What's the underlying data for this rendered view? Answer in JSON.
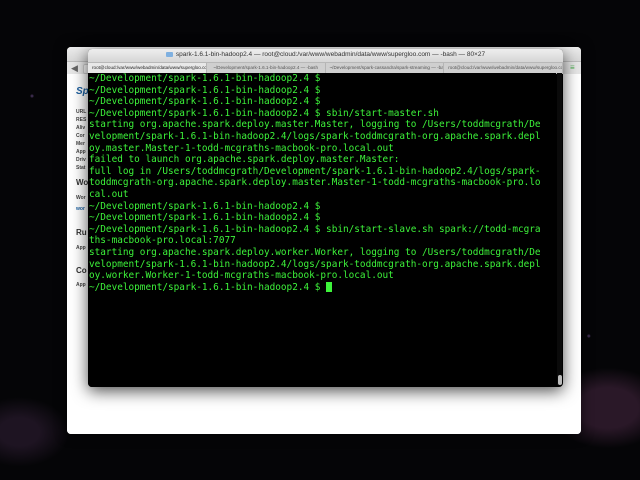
{
  "terminal": {
    "title": "spark-1.6.1-bin-hadoop2.4 — root@cloud:/var/www/webadmin/data/www/supergloo.com — -bash — 80×27",
    "tabs": [
      "root@cloud:/var/www/webadmin/data/www/supergloo.com",
      "~/Development/spark-1.6.1-bin-hadoop2.4 — -bash",
      "~/Development/spark-cassandra/spark-streaming — -bash",
      "root@cloud:/var/www/webadmin/data/www/supergloo.com/"
    ],
    "lines": [
      "~/Development/spark-1.6.1-bin-hadoop2.4 $",
      "~/Development/spark-1.6.1-bin-hadoop2.4 $",
      "~/Development/spark-1.6.1-bin-hadoop2.4 $",
      "~/Development/spark-1.6.1-bin-hadoop2.4 $ sbin/start-master.sh",
      "starting org.apache.spark.deploy.master.Master, logging to /Users/toddmcgrath/De",
      "velopment/spark-1.6.1-bin-hadoop2.4/logs/spark-toddmcgrath-org.apache.spark.depl",
      "oy.master.Master-1-todd-mcgraths-macbook-pro.local.out",
      "failed to launch org.apache.spark.deploy.master.Master:",
      "full log in /Users/toddmcgrath/Development/spark-1.6.1-bin-hadoop2.4/logs/spark-",
      "toddmcgrath-org.apache.spark.deploy.master.Master-1-todd-mcgraths-macbook-pro.lo",
      "cal.out",
      "~/Development/spark-1.6.1-bin-hadoop2.4 $",
      "~/Development/spark-1.6.1-bin-hadoop2.4 $",
      "~/Development/spark-1.6.1-bin-hadoop2.4 $ sbin/start-slave.sh spark://todd-mcgra",
      "ths-macbook-pro.local:7077",
      "starting org.apache.spark.deploy.worker.Worker, logging to /Users/toddmcgrath/De",
      "velopment/spark-1.6.1-bin-hadoop2.4/logs/spark-toddmcgrath-org.apache.spark.depl",
      "oy.worker.Worker-1-todd-mcgraths-macbook-pro.local.out"
    ],
    "prompt": "~/Development/spark-1.6.1-bin-hadoop2.4 $ "
  },
  "browser": {
    "sidebar_title": "Sp",
    "sidebar_labels": [
      "URL",
      "RES",
      "Aliv",
      "Cor",
      "Mer",
      "App",
      "Driv",
      "Stat"
    ],
    "sections": [
      "Wo",
      "Ru",
      "Co"
    ],
    "small_labels": [
      "Wor",
      "wor",
      "App",
      "App"
    ]
  },
  "colors": {
    "terminal_text": "#3df23a",
    "terminal_bg": "#000000"
  }
}
